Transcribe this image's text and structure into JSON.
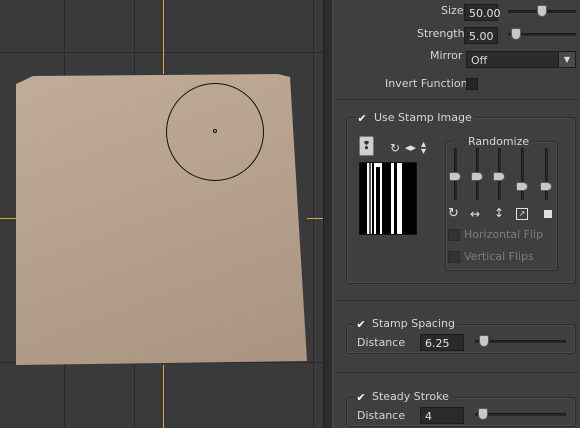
{
  "tool": {
    "size_label": "Size",
    "size_value": "50.00",
    "size_fraction": 0.5,
    "strength_label": "Strength",
    "strength_value": "5.00",
    "strength_fraction": 0.05,
    "mirror_label": "Mirror",
    "mirror_value": "Off",
    "invert_label": "Invert Function",
    "invert_checked": false
  },
  "stamp": {
    "use_label": "Use Stamp Image",
    "use_checked": true,
    "randomize_label": "Randomize",
    "randomize_checked": false,
    "horizontal_flip_label": "Horizontal Flip",
    "vertical_flips_label": "Vertical Flips",
    "random_slider_levels": [
      0.45,
      0.45,
      0.45,
      0.2,
      0.2
    ],
    "icons": [
      "brush-type-icon",
      "rotate-icon",
      "flip-horizontal-icon",
      "flip-vertical-icon"
    ],
    "random_icons": [
      "rotate-icon",
      "horizontal-arrows-icon",
      "vertical-arrows-icon",
      "resize-icon",
      "square-icon"
    ]
  },
  "spacing": {
    "label": "Stamp Spacing",
    "checked": true,
    "distance_label": "Distance",
    "distance_value": "6.25",
    "distance_fraction": 0.05
  },
  "steady": {
    "label": "Steady Stroke",
    "checked": true,
    "distance_label": "Distance",
    "distance_value": "4",
    "distance_fraction": 0.04
  },
  "colors": {
    "panel": "#3f3f3f",
    "viewport": "#3a3a3a",
    "mesh": "#b8a391",
    "grid_axis": "#cfae3a"
  }
}
